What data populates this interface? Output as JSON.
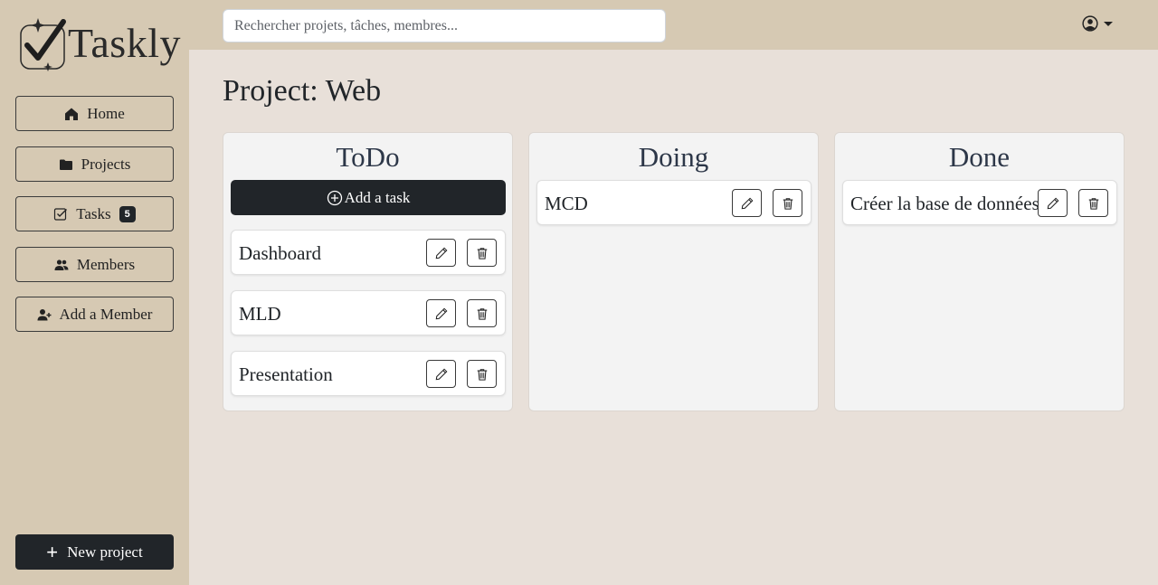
{
  "app": {
    "name": "Taskly"
  },
  "search": {
    "placeholder": "Rechercher projets, tâches, membres..."
  },
  "sidebar": {
    "items": [
      {
        "label": "Home",
        "icon": "house-icon"
      },
      {
        "label": "Projects",
        "icon": "folder-icon"
      },
      {
        "label": "Tasks",
        "icon": "check-square-icon",
        "badge": "5"
      },
      {
        "label": "Members",
        "icon": "people-icon"
      },
      {
        "label": "Add a Member",
        "icon": "person-add-icon"
      }
    ],
    "new_project_label": "New project"
  },
  "page": {
    "title": "Project: Web"
  },
  "board": {
    "add_task_label": "Add a task",
    "columns": [
      {
        "title": "ToDo",
        "tasks": [
          "Dashboard",
          "MLD",
          "Presentation"
        ]
      },
      {
        "title": "Doing",
        "tasks": [
          "MCD"
        ]
      },
      {
        "title": "Done",
        "tasks": [
          "Créer la base de données"
        ]
      }
    ]
  },
  "colors": {
    "sidebar_bg": "#d6c9b3",
    "main_bg": "#e8e0d9",
    "dark_button": "#212529",
    "column_bg": "#f3f3f3"
  }
}
